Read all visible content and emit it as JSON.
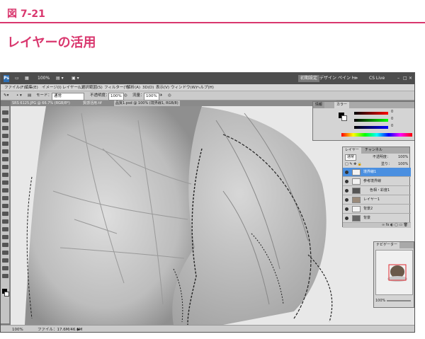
{
  "page": {
    "figure_label": "図 7-21",
    "title": "レイヤーの活用"
  },
  "app": {
    "topbar": {
      "zoom": "100%",
      "workspace": "初期設定",
      "design": "デザイン",
      "paint": "ペイント",
      "cs_live": "CS Live"
    },
    "menu": [
      "ファイル(F)",
      "編集(E)",
      "イメージ(I)",
      "レイヤー(L)",
      "選択範囲(S)",
      "フィルター(T)",
      "解析(A)",
      "3D(D)",
      "表示(V)",
      "ウィンドウ(W)",
      "ヘルプ(H)"
    ],
    "options": {
      "mode_label": "モード：",
      "mode_value": "通常",
      "opacity_label": "不透明度：",
      "opacity_value": "100%",
      "flow_label": "流量：",
      "flow_value": "100%"
    },
    "doc_tabs": {
      "tab1": "SRS 6125.JPG @ 66.7% (RGB/8*)",
      "tab2": "質感活用.tif",
      "tab3": "品質1.psd @ 100% (境界線1, RGB/8)"
    },
    "status": {
      "zoom": "100%",
      "file": "ファイル：17.6M/46.6M"
    }
  },
  "panels": {
    "color": {
      "tab": "カラー",
      "r": "0",
      "g": "0",
      "b": "0",
      "pct": "%"
    },
    "navigator": {
      "tab_mini": "情報",
      "tab": "ナビゲーター",
      "zoom": "100%"
    },
    "layers": {
      "tabs": [
        "レイヤー",
        "チャンネル"
      ],
      "blend": "通常",
      "opacity_label": "不透明度：",
      "opacity": "100%",
      "fill_label": "塗り：",
      "fill": "100%",
      "rows": [
        "境界線1",
        "参考境界線",
        "色相・彩度1",
        "レイヤー1",
        "背景2",
        "背景"
      ]
    }
  },
  "colors": {
    "accent": "#d9376e",
    "selection": "#4a8fe0"
  }
}
